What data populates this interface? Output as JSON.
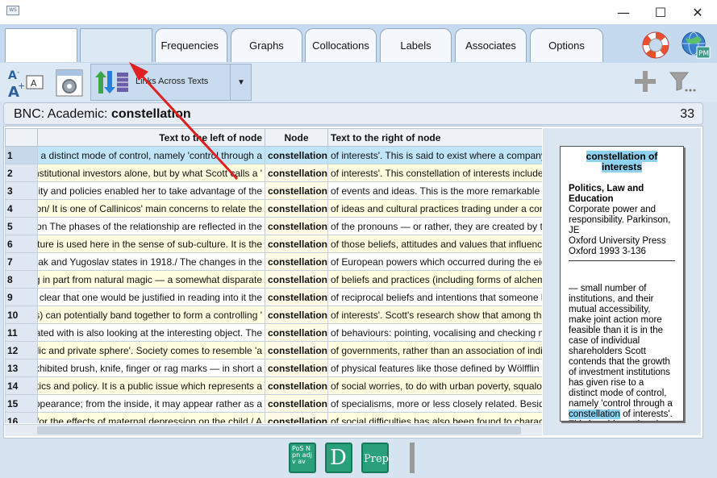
{
  "window": {
    "minimize_glyph": "—",
    "maximize_glyph": "☐",
    "close_glyph": "✕"
  },
  "tabs": [
    {
      "label": ""
    },
    {
      "label": ""
    },
    {
      "label": "Frequencies"
    },
    {
      "label": "Graphs"
    },
    {
      "label": "Collocations"
    },
    {
      "label": "Labels"
    },
    {
      "label": "Associates"
    },
    {
      "label": "Options"
    }
  ],
  "toolbar": {
    "links_label": "Links Across Texts",
    "dropdown_glyph": "▼"
  },
  "header": {
    "corpus": "BNC: Academic: ",
    "search_word": "constellation",
    "count": "33"
  },
  "table": {
    "columns": [
      "",
      "Text to the left of node",
      "Node",
      "Text to the right of node"
    ],
    "rows": [
      {
        "n": "1",
        "left": "se to a distinct mode of control, namely 'control through a",
        "node": "constellation",
        "right": "of interests'. This is said to exist where a company has"
      },
      {
        "n": "2",
        "left": "or institutional investors alone, but by what Scott calls a '",
        "node": "constellation",
        "right": "of interests'. This constellation of interests includes entities"
      },
      {
        "n": "3",
        "left": "sonality and policies enabled her to take advantage of the",
        "node": "constellation",
        "right": "of events and ideas. This is the more remarkable in view"
      },
      {
        "n": "4",
        "left": "volution/ It is one of Callinicos' main concerns to relate the",
        "node": "constellation",
        "right": "of ideas and cultural practices trading under a concept"
      },
      {
        "n": "5",
        "left": "rmation The phases of the relationship are reflected in the",
        "node": "constellation",
        "right": "of the pronouns — or rather, they are created by the"
      },
      {
        "n": "6",
        "left": "Culture is used here in the sense of sub-culture. It is the",
        "node": "constellation",
        "right": "of those beliefs, attitudes and values that influence such"
      },
      {
        "n": "7",
        "left": "oslovak and Yugoslav states in 1918./ The changes in the",
        "node": "constellation",
        "right": "of European powers which occurred during the eighteenth"
      },
      {
        "n": "8",
        "left": "prang in part from natural magic — a somewhat disparate",
        "node": "constellation",
        "right": "of beliefs and practices (including forms of alchemy and"
      },
      {
        "n": "9",
        "left": "s not clear that one would be justified in reading into it the",
        "node": "constellation",
        "right": "of reciprocal beliefs and intentions that someone like Lewis"
      },
      {
        "n": "10",
        "left": "panies) can potentially band together to form a controlling '",
        "node": "constellation",
        "right": "of interests'. Scott's research show that among the top"
      },
      {
        "n": "11",
        "left": "unicated with is also looking at the interesting object. The",
        "node": "constellation",
        "right": "of behaviours: pointing, vocalising and checking may be"
      },
      {
        "n": "12",
        "left": "e public and private sphere'. Society comes to resemble 'a",
        "node": "constellation",
        "right": "of governments, rather than an association of individuals"
      },
      {
        "n": "13",
        "left": "nt; exhibited brush, knife, finger or rag marks — in short a",
        "node": "constellation",
        "right": "of physical features like those defined by Wölfflin when"
      },
      {
        "n": "14",
        "left": "r politics and policy. It is a public issue which represents a",
        "node": "constellation",
        "right": "of social worries, to do with urban poverty, squalor, ill-health"
      },
      {
        "n": "15",
        "left": "of appearance; from the inside, it may appear rather as a",
        "node": "constellation",
        "right": "of specialisms, more or less closely related. Besides, don't"
      },
      {
        "n": "16",
        "left": "ble for  the effects of maternal depression on the child / A",
        "node": "constellation",
        "right": "of social difficulties has also been found to characterise"
      }
    ]
  },
  "sidecard": {
    "heading": "constellation of interests",
    "section": "Politics, Law and Education",
    "source_lines": [
      "Corporate power and responsibility. Parkinson, JE",
      "Oxford University Press",
      "Oxford 1993 3-136"
    ],
    "body_before": "— small number of institutions, and their mutual accessibility, make joint action more feasible than it is in the case of individual shareholders Scott contends that the growth of investment institutions has given rise to a distinct mode of control, namely 'control through a ",
    "body_highlight": "constellation",
    "body_after": " of interests'. This is said to exist where a company has a number of large shareholders who"
  },
  "bottom_buttons": [
    {
      "label": "PoS N pn adj v av"
    },
    {
      "label": "D"
    },
    {
      "label": "Prep"
    }
  ],
  "colors": {
    "accent_arrow": "#e02020",
    "selected_row": "#c0e4f8",
    "alt_row": "#fffde0",
    "icon_green": "#2aa07a"
  }
}
